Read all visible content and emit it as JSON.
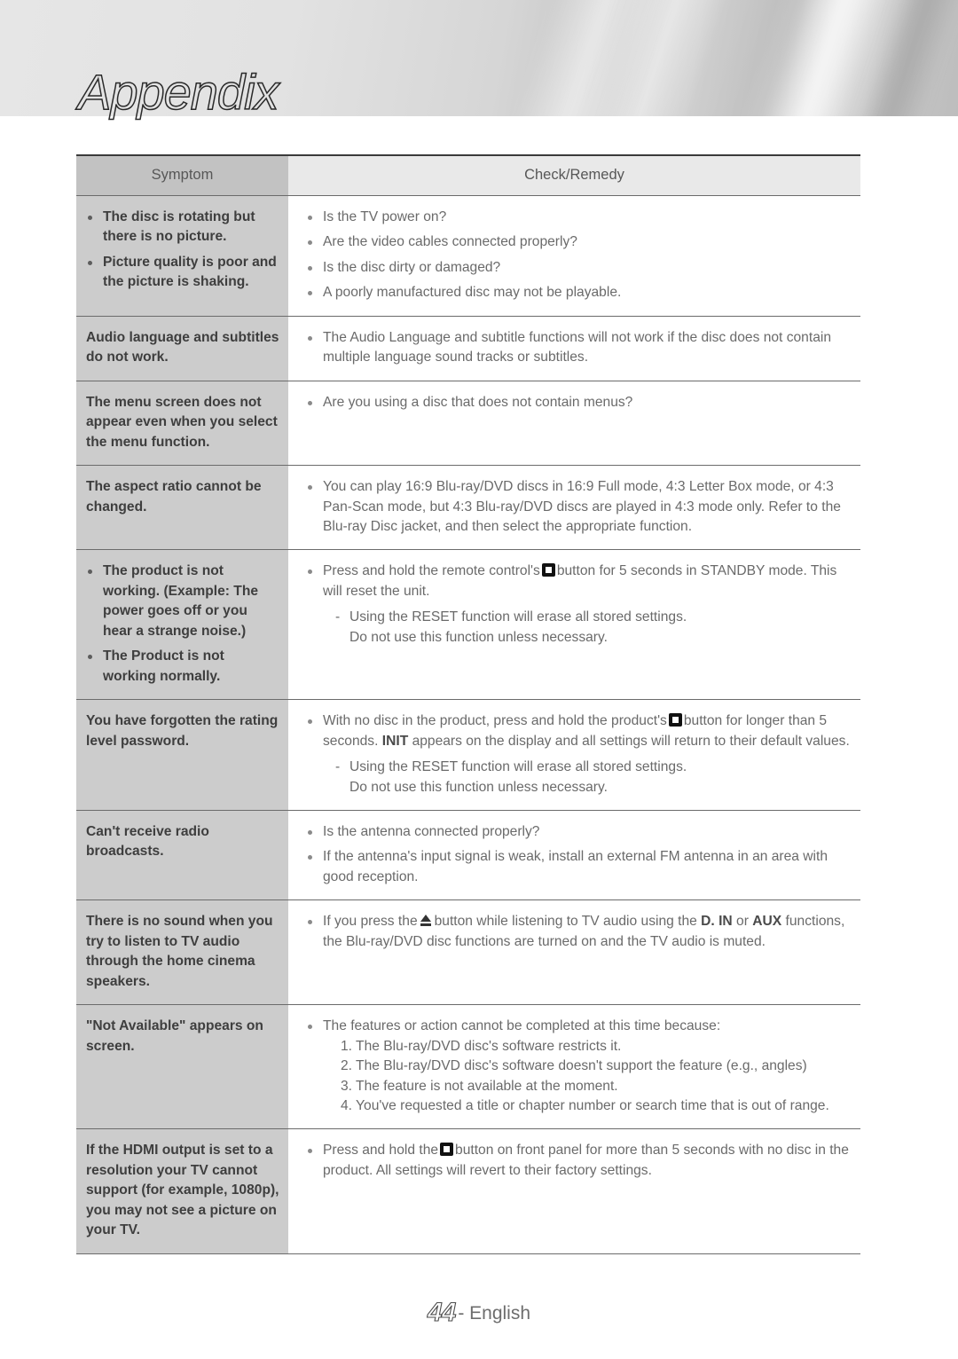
{
  "header": {
    "chapter_title": "Appendix"
  },
  "table": {
    "columns": [
      "Symptom",
      "Check/Remedy"
    ],
    "rows": [
      {
        "symptom_bullets": [
          "The disc is rotating but there is no picture.",
          "Picture quality is poor and the picture is shaking."
        ],
        "remedy_bullets": [
          "Is the TV power on?",
          "Are the video cables connected properly?",
          "Is the disc dirty or damaged?",
          "A poorly manufactured disc may not be playable."
        ]
      },
      {
        "symptom_plain": "Audio language and subtitles do not work.",
        "remedy_bullets": [
          "The Audio Language and subtitle functions will not work if the disc does not contain multiple language sound tracks or subtitles."
        ]
      },
      {
        "symptom_plain": "The menu screen does not appear even when you select the menu function.",
        "remedy_bullets": [
          "Are you using a disc that does not contain menus?"
        ]
      },
      {
        "symptom_plain": "The aspect ratio cannot be changed.",
        "remedy_bullets": [
          "You can play 16:9 Blu-ray/DVD discs in 16:9 Full mode, 4:3 Letter Box mode, or 4:3 Pan-Scan mode, but 4:3 Blu-ray/DVD discs are played in 4:3 mode only. Refer to the Blu-ray Disc jacket, and then select the appropriate function."
        ]
      },
      {
        "symptom_bullets": [
          "The product is not working. (Example: The power goes off or you hear a strange noise.)",
          "The Product is not working normally."
        ],
        "remedy_rich": {
          "pre": "Press and hold the remote control's",
          "icon": "stop-icon",
          "post": "button for 5 seconds in STANDBY mode. This will reset the unit.",
          "sub": "Using the RESET function will erase all stored settings.",
          "sub2": "Do not use this function unless necessary."
        }
      },
      {
        "symptom_plain": "You have forgotten the rating level password.",
        "remedy_rich": {
          "pre": "With no disc in the product, press and hold the product's",
          "icon": "stop-icon",
          "post_a": "button for longer than 5 seconds.",
          "bold": "INIT",
          "post_b": "appears on the display and all settings will return to their default values.",
          "sub": "Using the RESET function will erase all stored settings.",
          "sub2": "Do not use this function unless necessary."
        }
      },
      {
        "symptom_plain": "Can't receive radio broadcasts.",
        "remedy_bullets": [
          "Is the antenna connected properly?",
          "If the antenna's input signal is weak, install an external FM antenna in an area with good reception."
        ]
      },
      {
        "symptom_plain": "There is no sound when you try to listen to TV audio through the home cinema speakers.",
        "remedy_rich": {
          "pre": "If you press the",
          "icon": "eject-icon",
          "post_a": "button while listening to TV audio using the",
          "bold_a": "D. IN",
          "mid": "or",
          "bold_b": "AUX",
          "post_b": "functions, the Blu-ray/DVD disc functions are turned on and the TV audio is muted."
        }
      },
      {
        "symptom_plain": "\"Not Available\" appears on screen.",
        "remedy_list": {
          "lead": "The features or action cannot be completed at this time because:",
          "items": [
            "1. The Blu-ray/DVD disc's software restricts it.",
            "2. The Blu-ray/DVD disc's software doesn't support the feature (e.g., angles)",
            "3. The feature is not available at the moment.",
            "4. You've requested a title or chapter number or search time that is out of range."
          ]
        }
      },
      {
        "symptom_plain": "If the HDMI output is set to a resolution your TV cannot support (for example, 1080p), you may not see a picture on your TV.",
        "remedy_rich": {
          "pre": "Press and hold the",
          "icon": "stop-icon",
          "post": "button on front panel for more than 5 seconds with no disc in the product. All settings will revert to their factory settings."
        }
      }
    ]
  },
  "footer": {
    "page_number": "44",
    "language": "- English"
  }
}
